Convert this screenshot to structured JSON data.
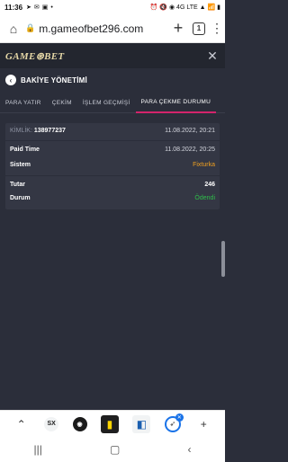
{
  "status_bar": {
    "time": "11:36",
    "notifications": [
      "arrow-icon",
      "messenger-icon",
      "image-icon",
      "dot"
    ],
    "indicators": "⏰ 🔇 ◉ 4G LTE ▲ 📶 ▮"
  },
  "browser": {
    "url": "m.gameofbet296.com",
    "tab_count": "1"
  },
  "site": {
    "logo_text": "GAME⊛BET"
  },
  "page": {
    "title": "BAKİYE YÖNETİMİ"
  },
  "tabs": [
    {
      "label": "PARA YATIR"
    },
    {
      "label": "ÇEKİM"
    },
    {
      "label": "İŞLEM GEÇMİŞİ"
    },
    {
      "label": "PARA ÇEKME DURUMU"
    }
  ],
  "record": {
    "id_label": "KİMLİK:",
    "id_value": "138977237",
    "created": "11.08.2022, 20:21",
    "paid_time_label": "Paid Time",
    "paid_time_value": "11.08.2022, 20:25",
    "system_label": "Sistem",
    "system_value": "Fixturka",
    "amount_label": "Tutar",
    "amount_value": "246",
    "status_label": "Durum",
    "status_value": "Ödendi"
  },
  "colors": {
    "accent": "#d3246b",
    "system": "#f0a020",
    "paid": "#2fbf4a"
  }
}
